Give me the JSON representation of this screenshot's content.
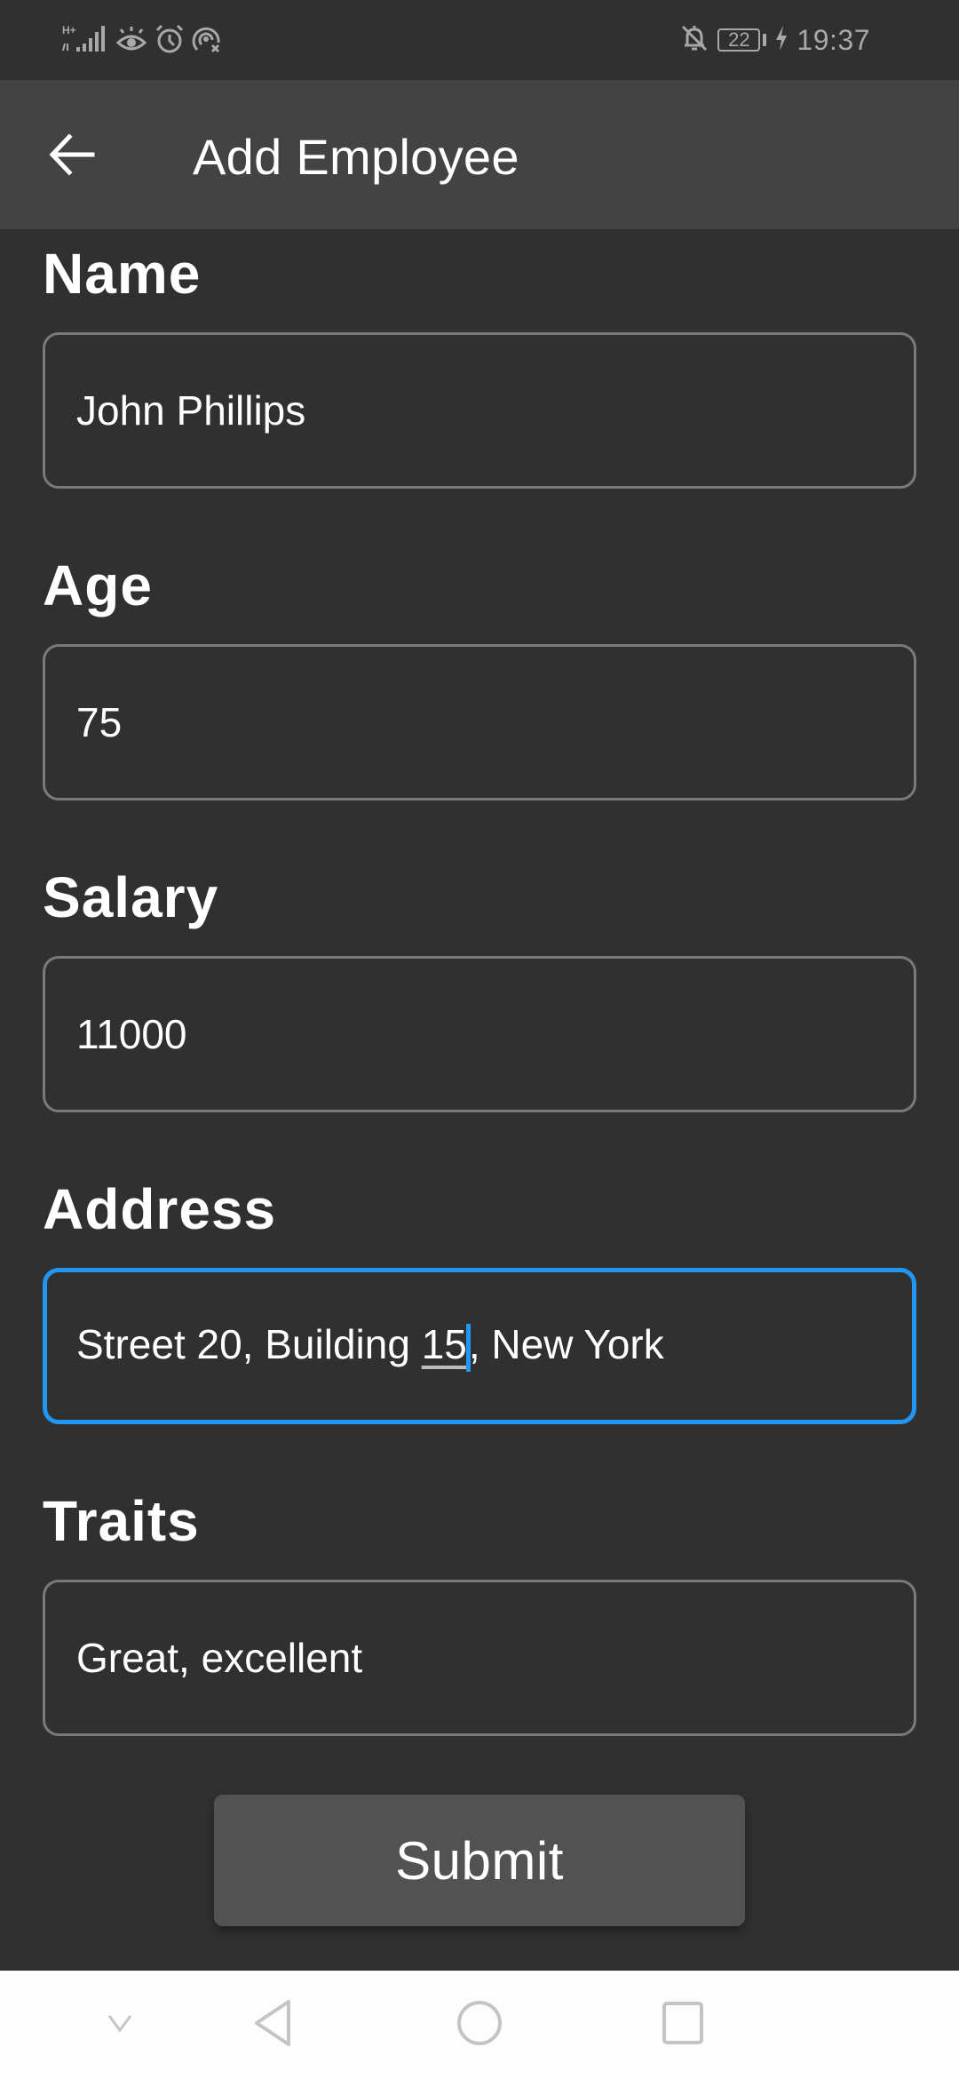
{
  "status_bar": {
    "network_label": "H+",
    "battery_level": "22",
    "time": "19:37",
    "icons_left": [
      "signal-icon",
      "eye-comfort-icon",
      "alarm-icon",
      "hotspot-off-icon"
    ],
    "icons_right": [
      "notifications-muted-icon",
      "battery-icon",
      "charging-icon"
    ]
  },
  "app_bar": {
    "title": "Add Employee",
    "back_icon": "arrow-left-icon"
  },
  "form": {
    "fields": [
      {
        "label": "Name",
        "value": "John Phillips",
        "focused": false
      },
      {
        "label": "Age",
        "value": "75",
        "focused": false
      },
      {
        "label": "Salary",
        "value": "11000",
        "focused": false
      },
      {
        "label": "Address",
        "value": "Street 20, Building 15, New York",
        "value_before_composing": "Street 20, Building ",
        "composing_text": "15",
        "value_after_caret": ", New York",
        "focused": true
      },
      {
        "label": "Traits",
        "value": "Great, excellent",
        "focused": false
      }
    ],
    "submit_label": "Submit"
  },
  "colors": {
    "background": "#303030",
    "app_bar": "#434343",
    "focus_accent": "#2196f3",
    "field_border": "#7a7a7a",
    "button": "#525252",
    "nav_bar": "#fdfdfd"
  },
  "nav_bar": {
    "buttons": [
      "hide-keyboard",
      "back",
      "home",
      "recents"
    ]
  }
}
